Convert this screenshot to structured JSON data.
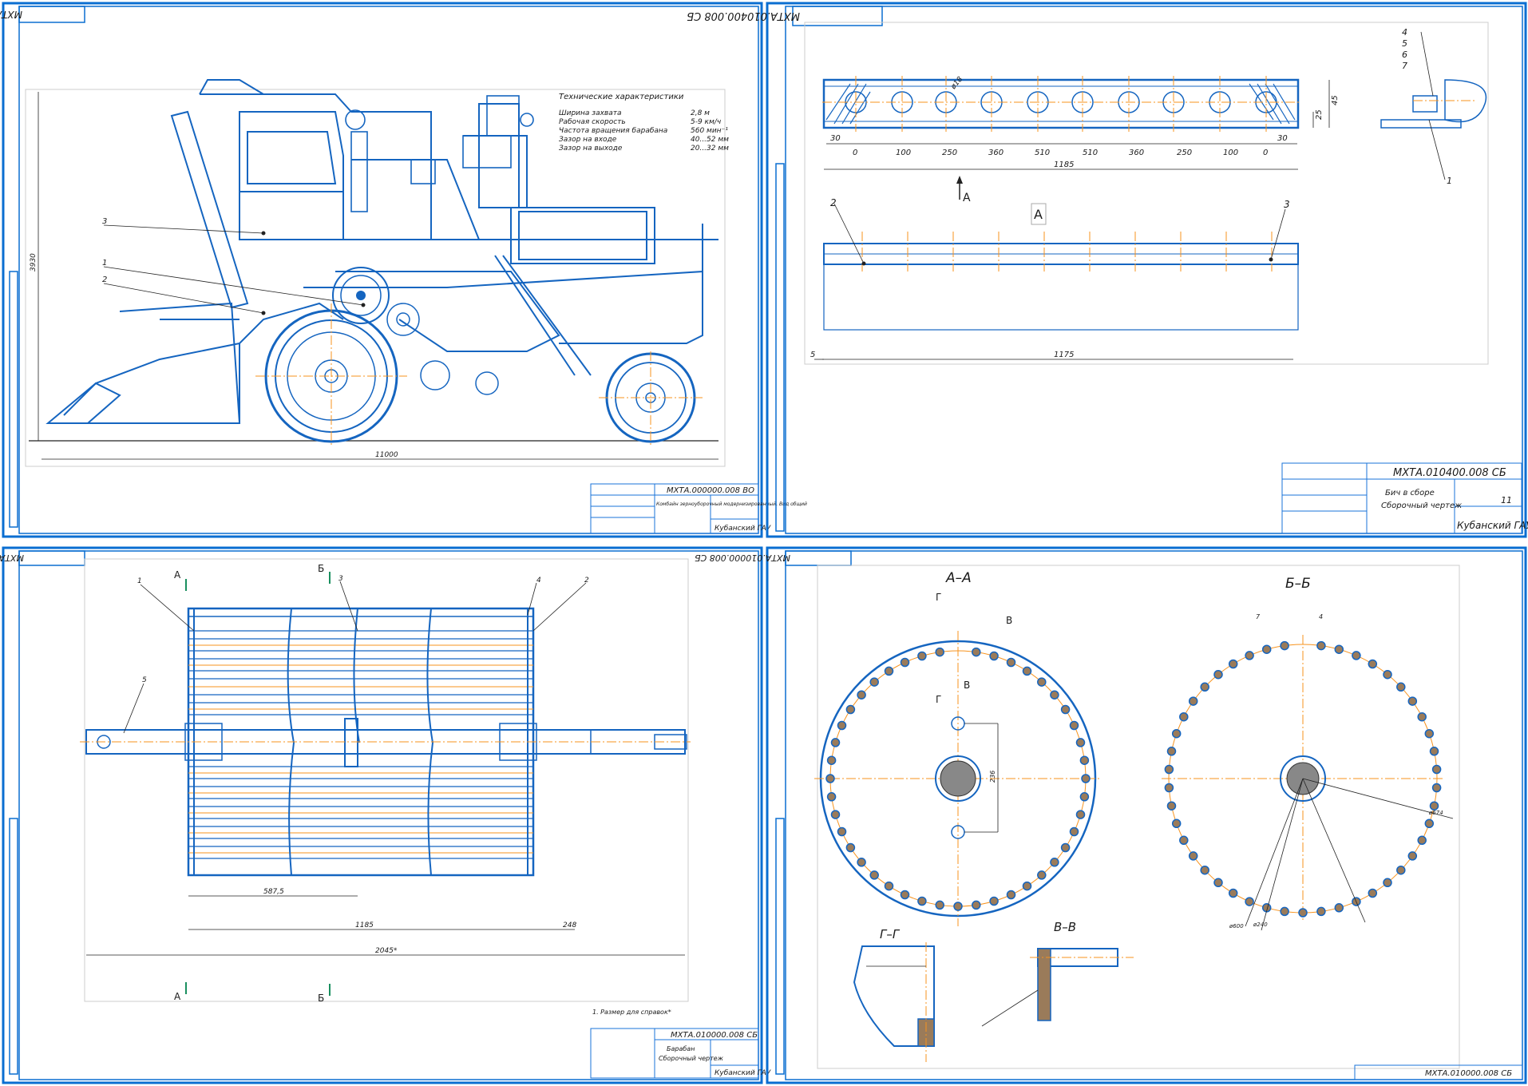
{
  "sheets": {
    "s1": {
      "stamp": "МХТА.000000.008 ВО",
      "spec_title": "Технические характеристики",
      "specs": [
        {
          "k": "Ширина захвата",
          "v": "2,8  м"
        },
        {
          "k": "Рабочая скорость",
          "v": "5-9  км/ч"
        },
        {
          "k": "Частота вращения барабана",
          "v": "560  мин⁻¹"
        },
        {
          "k": "Зазор на входе",
          "v": "40...52  мм"
        },
        {
          "k": "Зазор на выходе",
          "v": "20...32  мм"
        }
      ],
      "tb_name": "Комбайн зерноуборочный модернизированный. Вид общий",
      "org": "Кубанский ГАУ",
      "dim_w": "11000",
      "dim_h": "3930",
      "callouts": [
        "3",
        "1",
        "2"
      ]
    },
    "s2": {
      "stamp": "МХТА.010400.008 СБ",
      "tb_code": "МХТА.010400.008 СБ",
      "tb_name1": "Бич в сборе",
      "tb_name2": "Сборочный чертеж",
      "sheet_no": "11",
      "org": "Кубанский ГАУ",
      "view_label": "А",
      "arrow_label": "А",
      "dims_top": [
        "30",
        "0",
        "100",
        "250",
        "360",
        "510",
        "510",
        "360",
        "250",
        "100",
        "0",
        "30"
      ],
      "dim_total": "1185",
      "dim_h1": "45",
      "dim_h2": "25",
      "dim_hole": "ø18",
      "dim_len": "1175",
      "dim_5": "5",
      "callouts": [
        "2",
        "3",
        "4",
        "5",
        "6",
        "7",
        "1"
      ]
    },
    "s3": {
      "stamp": "МХТА.010000.008 СБ",
      "tb_name1": "Барабан",
      "tb_name2": "Сборочный чертеж",
      "org": "Кубанский ГАУ",
      "note": "1. Размер для справок*",
      "sec_a": "А",
      "sec_b": "Б",
      "dims": [
        "587,5",
        "1185",
        "2045*",
        "248"
      ],
      "callouts": [
        "1",
        "3",
        "4",
        "2",
        "5"
      ]
    },
    "s4": {
      "stamp": "МХТА.010000.008 СБ",
      "tb_code": "МХТА.010000.008 СБ",
      "sec_aa": "А–А",
      "sec_bb": "Б–Б",
      "sec_gg": "Г–Г",
      "sec_vv": "В–В",
      "g_label": "Г",
      "v_label": "В",
      "dims": [
        "ø600",
        "ø240",
        "ø674",
        "236"
      ],
      "callouts": [
        "7",
        "4"
      ]
    }
  },
  "colors": {
    "frame": "#0a6ed1",
    "line": "#1565c0",
    "center": "#f7931e",
    "text": "#1a1a1a"
  }
}
